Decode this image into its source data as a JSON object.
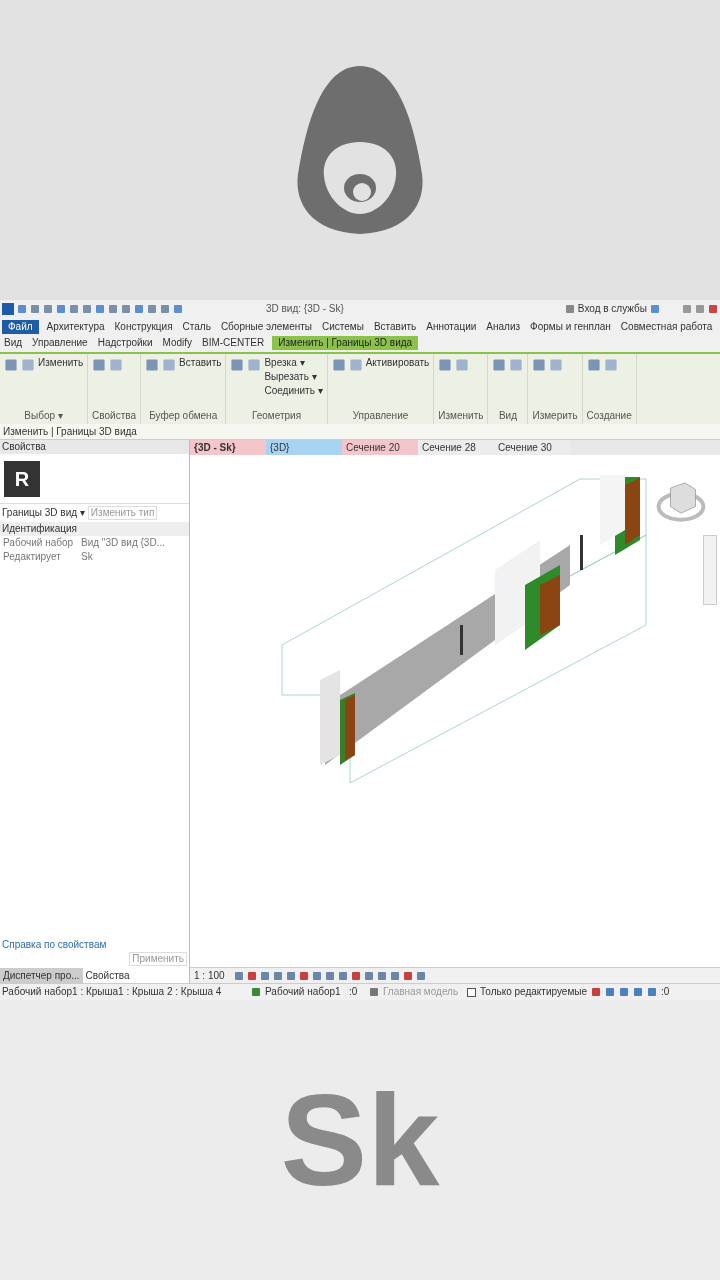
{
  "title_bar": {
    "title": "3D вид: {3D - Sk}",
    "sign_in": "Вход в службы"
  },
  "ribbon_tabs": [
    {
      "label": "Файл",
      "selected": false,
      "kind": "file"
    },
    {
      "label": "Архитектура",
      "selected": false,
      "kind": "tab"
    },
    {
      "label": "Конструкция",
      "selected": false,
      "kind": "tab"
    },
    {
      "label": "Сталь",
      "selected": false,
      "kind": "tab"
    },
    {
      "label": "Сборные элементы",
      "selected": false,
      "kind": "tab"
    },
    {
      "label": "Системы",
      "selected": false,
      "kind": "tab"
    },
    {
      "label": "Вставить",
      "selected": false,
      "kind": "tab"
    },
    {
      "label": "Аннотации",
      "selected": false,
      "kind": "tab"
    },
    {
      "label": "Анализ",
      "selected": false,
      "kind": "tab"
    },
    {
      "label": "Формы и генплан",
      "selected": false,
      "kind": "tab"
    },
    {
      "label": "Совместная работа",
      "selected": false,
      "kind": "tab"
    },
    {
      "label": "Вид",
      "selected": false,
      "kind": "tab"
    },
    {
      "label": "Управление",
      "selected": false,
      "kind": "tab"
    },
    {
      "label": "Надстройки",
      "selected": false,
      "kind": "tab"
    },
    {
      "label": "Modify",
      "selected": false,
      "kind": "tab"
    },
    {
      "label": "BIM-CENTER",
      "selected": false,
      "kind": "tab"
    },
    {
      "label": "Изменить | Границы 3D вида",
      "selected": true,
      "kind": "context"
    }
  ],
  "ribbon_panels": [
    {
      "label": "Выбор ▾",
      "buttons": [
        "Изменить"
      ]
    },
    {
      "label": "Свойства"
    },
    {
      "label": "Буфер обмена",
      "buttons": [
        "Вставить"
      ]
    },
    {
      "label": "Геометрия",
      "buttons": [
        "Врезка ▾",
        "Вырезать ▾",
        "Соединить ▾"
      ]
    },
    {
      "label": "Управление",
      "buttons": [
        "Активировать"
      ]
    },
    {
      "label": "Изменить"
    },
    {
      "label": "Вид"
    },
    {
      "label": "Измерить"
    },
    {
      "label": "Создание"
    }
  ],
  "context_line": "Изменить | Границы 3D вида",
  "properties": {
    "title": "Свойства",
    "logo_letter": "R",
    "type": "Границы 3D вид ▾",
    "edit_type": "Изменить тип",
    "section": "Идентификация",
    "rows": [
      {
        "name": "Рабочий набор",
        "value": "Вид \"3D вид {3D..."
      },
      {
        "name": "Редактирует",
        "value": "Sk"
      }
    ],
    "help_link": "Справка по свойствам",
    "apply": "Применить",
    "tabs": [
      {
        "label": "Диспетчер про...",
        "selected": false
      },
      {
        "label": "Свойства",
        "selected": true
      }
    ]
  },
  "view_tabs": [
    {
      "label": "{3D - Sk}",
      "selected": true,
      "color": "#f4c6cc"
    },
    {
      "label": "{3D}",
      "selected": false,
      "color": "#a9d3f2"
    },
    {
      "label": "Сечение 20",
      "selected": false,
      "color": "#f4c6cc"
    },
    {
      "label": "Сечение 28",
      "selected": false,
      "color": "#ececec"
    },
    {
      "label": "Сечение 30",
      "selected": false,
      "color": "#ececec"
    }
  ],
  "view_bar": {
    "scale": "1 : 100"
  },
  "status_bar": {
    "message": "Рабочий набор1 : Крыша1 : Крыша 2 : Крыша 4",
    "workset": "Рабочий набор1",
    "count": ":0",
    "model": "Главная модель",
    "editable_only": {
      "label": "Только редактируемые",
      "checked": false
    },
    "filter": ":0"
  },
  "bottom_caption": "Sk"
}
